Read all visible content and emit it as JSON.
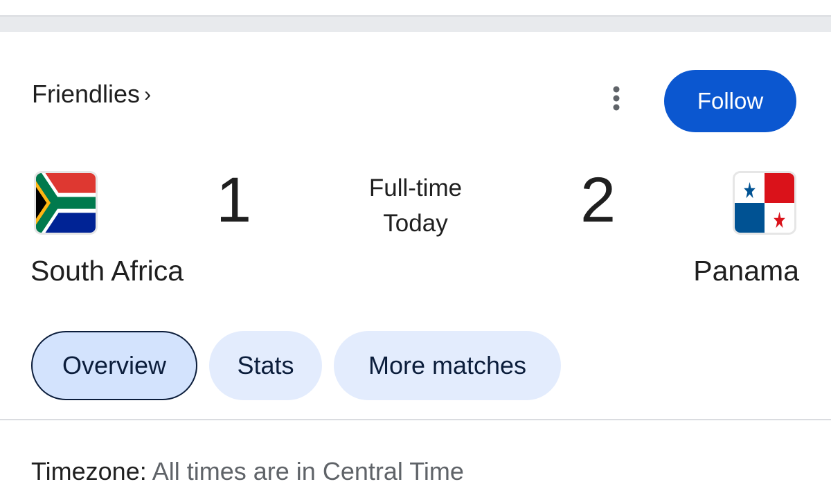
{
  "league": {
    "label": "Friendlies",
    "chevron_icon": "chevron-right-icon"
  },
  "header": {
    "more_icon": "more-vert-icon",
    "follow_label": "Follow",
    "follow_color": "#0b57d0"
  },
  "match": {
    "home": {
      "name": "South Africa",
      "score": "1",
      "flag_icon": "south-africa-flag-icon"
    },
    "away": {
      "name": "Panama",
      "score": "2",
      "flag_icon": "panama-flag-icon"
    },
    "status": "Full-time",
    "date": "Today"
  },
  "tabs": [
    {
      "label": "Overview",
      "selected": true
    },
    {
      "label": "Stats",
      "selected": false
    },
    {
      "label": "More matches",
      "selected": false
    }
  ],
  "timezone": {
    "label": "Timezone:",
    "value": "All times are in Central Time"
  }
}
